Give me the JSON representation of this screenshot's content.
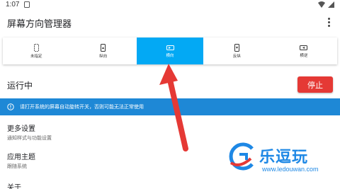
{
  "status_bar": {
    "time": "1:07"
  },
  "app_bar": {
    "title": "屏幕方向管理器"
  },
  "orientation_options": [
    {
      "label": "未指定",
      "icon": "phone-unspecified-icon",
      "selected": false
    },
    {
      "label": "纵向",
      "icon": "phone-portrait-icon",
      "selected": false
    },
    {
      "label": "横向",
      "icon": "phone-landscape-icon",
      "selected": true
    },
    {
      "label": "反纵",
      "icon": "phone-reverse-portrait-icon",
      "selected": false
    },
    {
      "label": "横逆",
      "icon": "phone-reverse-landscape-icon",
      "selected": false
    }
  ],
  "status": {
    "running_label": "运行中",
    "stop_label": "停止"
  },
  "info_banner": {
    "message": "请打开系统的屏幕自动旋转开关，否则可能无法正常使用"
  },
  "settings": [
    {
      "title": "更多设置",
      "subtitle": "通知样式与功能设置"
    },
    {
      "title": "应用主题",
      "subtitle": "跟随系统"
    },
    {
      "title": "关于",
      "subtitle": ""
    }
  ],
  "watermark": {
    "brand": "乐逗玩",
    "url": "www.ledouwan.com"
  },
  "colors": {
    "accent": "#03a9f4",
    "banner": "#1e88d6",
    "stop": "#e53935",
    "arrow": "#e53935"
  }
}
